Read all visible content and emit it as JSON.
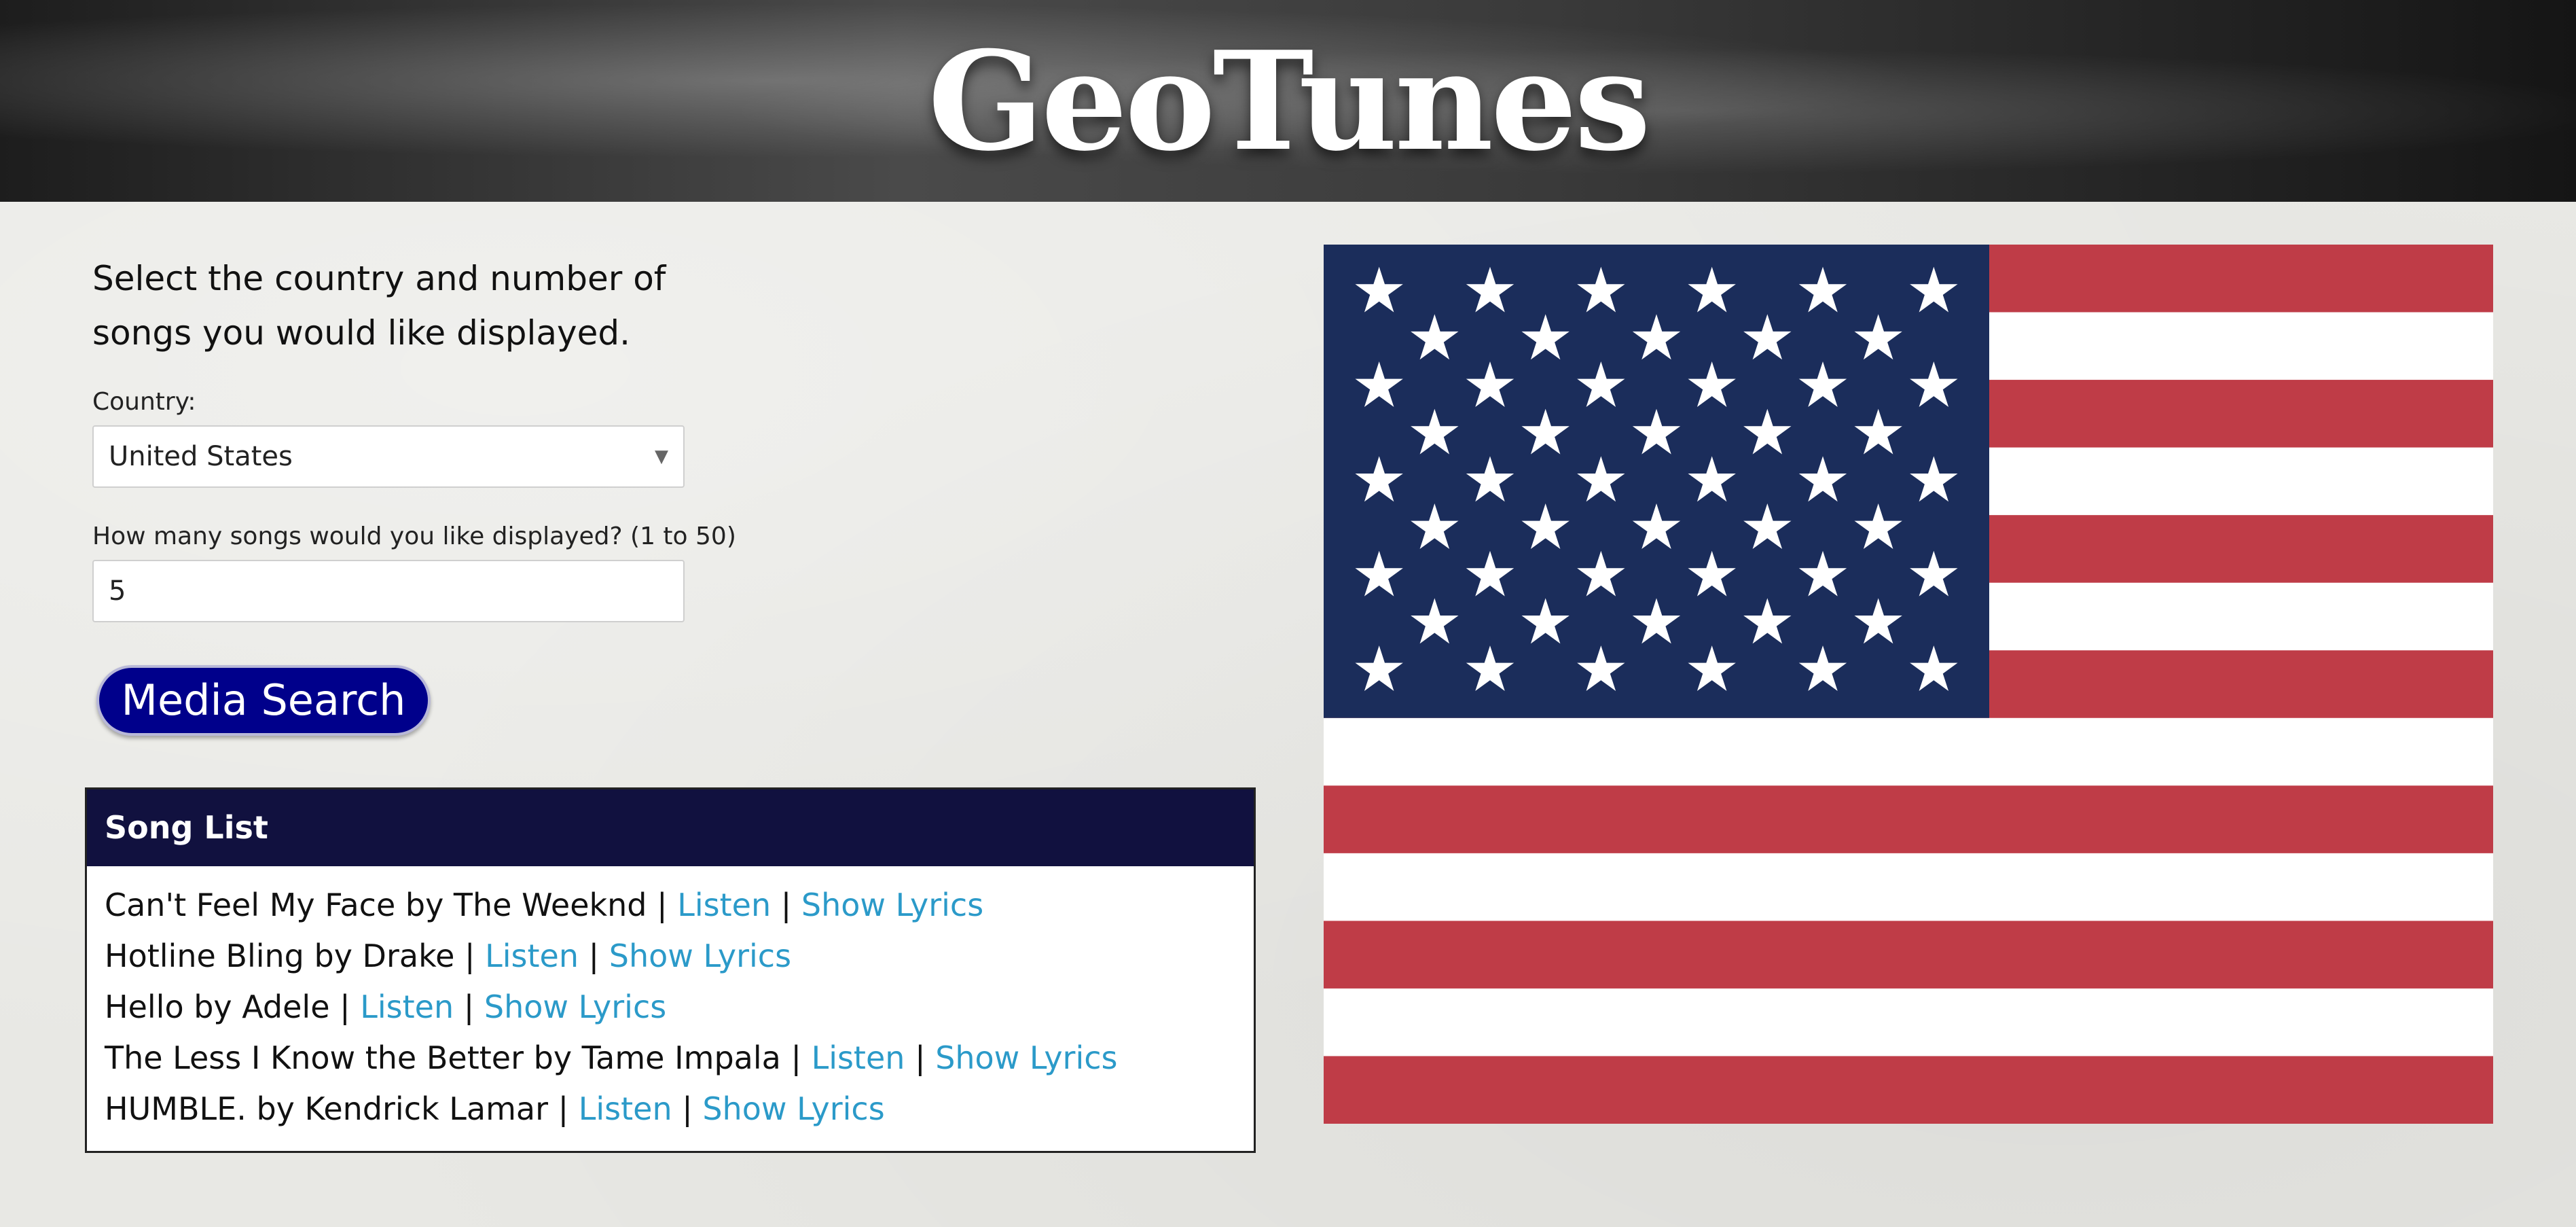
{
  "header": {
    "title": "GeoTunes"
  },
  "form": {
    "instructions": "Select the country and number of songs you would like displayed.",
    "country_label": "Country:",
    "country_value": "United States",
    "count_label": "How many songs would you like displayed? (1 to 50)",
    "count_value": "5",
    "search_button": "Media Search"
  },
  "song_list": {
    "title": "Song List",
    "separator": "|",
    "listen_label": "Listen",
    "lyrics_label": "Show Lyrics",
    "items": [
      {
        "text": "Can't Feel My Face by The Weeknd"
      },
      {
        "text": "Hotline Bling by Drake"
      },
      {
        "text": "Hello by Adele"
      },
      {
        "text": "The Less I Know the Better by Tame Impala"
      },
      {
        "text": "HUMBLE. by Kendrick Lamar"
      }
    ]
  },
  "flag": {
    "country": "United States",
    "colors": {
      "red": "#bf3c47",
      "white": "#ffffff",
      "blue": "#1b2d5b"
    }
  },
  "colors": {
    "header_bg": "#2a2a2a",
    "page_bg": "#e8e8e4",
    "button_bg": "#00008b",
    "panel_header_bg": "#11113f",
    "link": "#2b9ac9"
  }
}
